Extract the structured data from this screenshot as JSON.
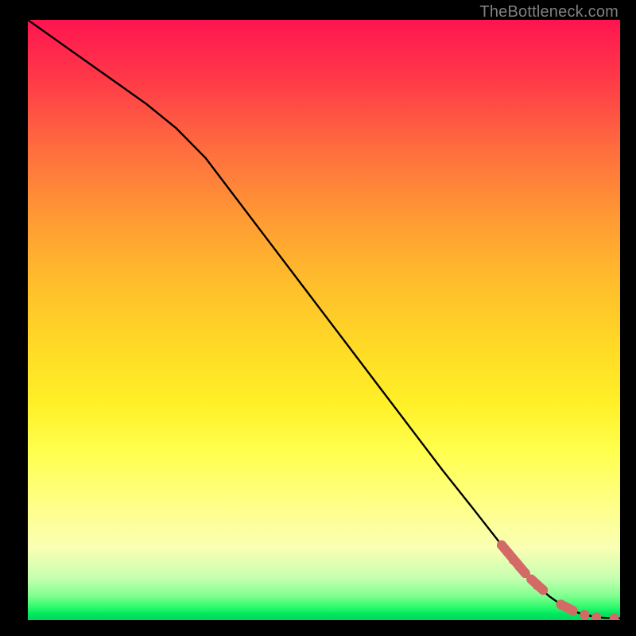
{
  "watermark": "TheBottleneck.com",
  "chart_data": {
    "type": "line",
    "title": "",
    "xlabel": "",
    "ylabel": "",
    "xlim": [
      0,
      100
    ],
    "ylim": [
      0,
      100
    ],
    "grid": false,
    "legend": false,
    "x": [
      0,
      5,
      10,
      15,
      20,
      25,
      30,
      35,
      40,
      45,
      50,
      55,
      60,
      65,
      70,
      75,
      80,
      82,
      84,
      86,
      88,
      90,
      91,
      92,
      93,
      94,
      95,
      96,
      97,
      98,
      99,
      100
    ],
    "y": [
      100.0,
      96.5,
      93.0,
      89.5,
      86.0,
      82.0,
      77.0,
      70.5,
      64.0,
      57.5,
      51.0,
      44.5,
      38.0,
      31.5,
      25.0,
      18.8,
      12.5,
      10.0,
      7.8,
      5.8,
      4.0,
      2.6,
      2.0,
      1.6,
      1.2,
      0.9,
      0.7,
      0.5,
      0.4,
      0.35,
      0.3,
      0.3
    ],
    "markers": {
      "x": [
        80,
        81,
        82,
        83,
        84,
        85,
        86,
        87,
        90,
        92,
        94,
        96,
        99
      ],
      "y": [
        12.5,
        11.3,
        10.0,
        8.9,
        7.8,
        6.8,
        5.8,
        5.0,
        2.6,
        1.6,
        0.9,
        0.5,
        0.3
      ]
    },
    "marker_segments": [
      {
        "x0": 80,
        "y0": 12.5,
        "x1": 84,
        "y1": 7.8
      },
      {
        "x0": 85,
        "y0": 6.8,
        "x1": 87,
        "y1": 5.0
      },
      {
        "x0": 90,
        "y0": 2.6,
        "x1": 92,
        "y1": 1.6
      }
    ],
    "colors": {
      "curve": "#000000",
      "marker": "#d36a66",
      "bg_top": "#ff1450",
      "bg_bottom": "#00d85a"
    }
  }
}
